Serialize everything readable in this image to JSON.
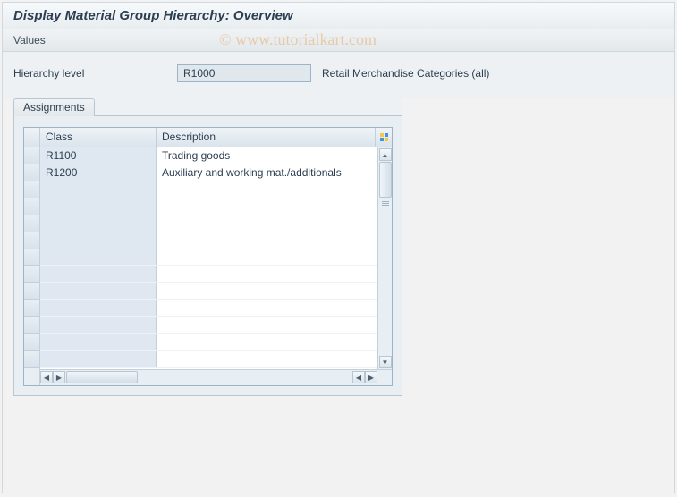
{
  "title": "Display Material Group Hierarchy: Overview",
  "toolbar": {
    "values_label": "Values"
  },
  "field": {
    "label": "Hierarchy level",
    "value": "R1000",
    "description": "Retail Merchandise Categories (all)"
  },
  "panel": {
    "tab_label": "Assignments",
    "columns": {
      "class": "Class",
      "description": "Description"
    },
    "rows": [
      {
        "class": "R1100",
        "description": "Trading goods"
      },
      {
        "class": "R1200",
        "description": "Auxiliary and working mat./additionals"
      }
    ]
  },
  "watermark": "© www.tutorialkart.com"
}
